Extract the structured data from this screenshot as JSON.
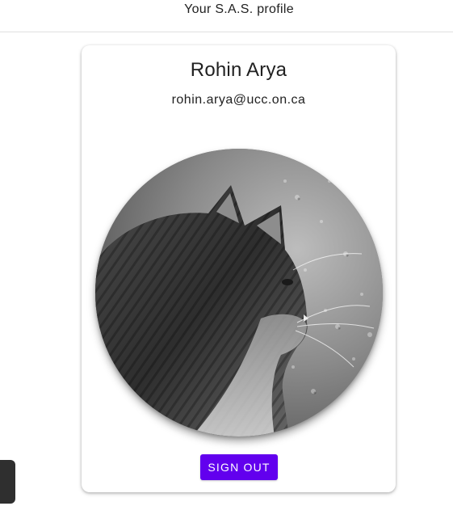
{
  "header": {
    "title": "Your S.A.S. profile"
  },
  "profile": {
    "name": "Rohin Arya",
    "email": "rohin.arya@ucc.on.ca",
    "avatar_alt": "profile photo"
  },
  "actions": {
    "sign_out_label": "SIGN OUT"
  },
  "colors": {
    "primary": "#6200ee",
    "side_tab": "#2f2f2f"
  }
}
